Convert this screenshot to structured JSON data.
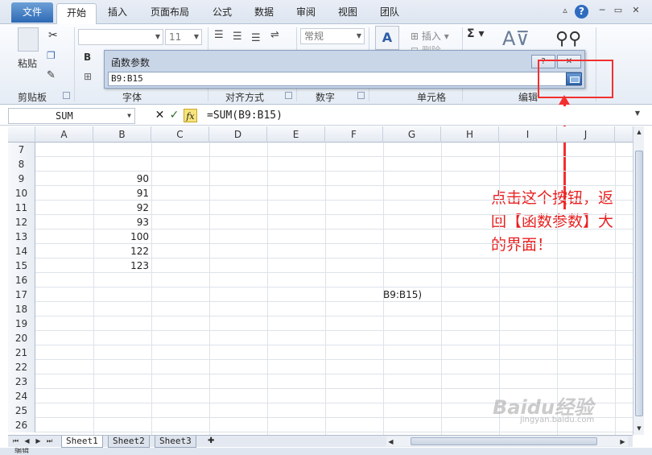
{
  "tabs": {
    "file": "文件",
    "items": [
      "开始",
      "插入",
      "页面布局",
      "公式",
      "数据",
      "审阅",
      "视图",
      "团队"
    ],
    "active_index": 0
  },
  "window_controls": {
    "help": "?",
    "minimize": "─",
    "restore": "▭",
    "close": "✕"
  },
  "ribbon": {
    "paste_label": "粘贴",
    "font_size": "11",
    "number_format": "常规",
    "insert_label": "插入",
    "delete_label": "删除",
    "sum_symbol": "Σ",
    "groups": [
      "剪贴板",
      "字体",
      "对齐方式",
      "数字",
      "单元格",
      "编辑"
    ]
  },
  "dialog": {
    "title": "函数参数",
    "help_btn": "?",
    "close_btn": "✕",
    "input_value": "B9:B15"
  },
  "formula_bar": {
    "name_box": "SUM",
    "cancel_icon": "✕",
    "enter_icon": "✓",
    "fx_label": "fx",
    "formula": "=SUM(B9:B15)"
  },
  "grid": {
    "columns": [
      "A",
      "B",
      "C",
      "D",
      "E",
      "F",
      "G",
      "H",
      "I",
      "J"
    ],
    "rows": [
      {
        "num": "7",
        "b": "",
        "g": ""
      },
      {
        "num": "8",
        "b": "",
        "g": ""
      },
      {
        "num": "9",
        "b": "90",
        "g": ""
      },
      {
        "num": "10",
        "b": "91",
        "g": ""
      },
      {
        "num": "11",
        "b": "92",
        "g": ""
      },
      {
        "num": "12",
        "b": "93",
        "g": ""
      },
      {
        "num": "13",
        "b": "100",
        "g": ""
      },
      {
        "num": "14",
        "b": "122",
        "g": ""
      },
      {
        "num": "15",
        "b": "123",
        "g": ""
      },
      {
        "num": "16",
        "b": "",
        "g": ""
      },
      {
        "num": "17",
        "b": "",
        "g": "B9:B15)"
      },
      {
        "num": "18",
        "b": "",
        "g": ""
      },
      {
        "num": "19",
        "b": "",
        "g": ""
      },
      {
        "num": "20",
        "b": "",
        "g": ""
      },
      {
        "num": "21",
        "b": "",
        "g": ""
      },
      {
        "num": "22",
        "b": "",
        "g": ""
      },
      {
        "num": "23",
        "b": "",
        "g": ""
      },
      {
        "num": "24",
        "b": "",
        "g": ""
      },
      {
        "num": "25",
        "b": "",
        "g": ""
      },
      {
        "num": "26",
        "b": "",
        "g": ""
      }
    ]
  },
  "sheets": [
    "Sheet1",
    "Sheet2",
    "Sheet3"
  ],
  "status": "编辑",
  "annotation": "点击这个按钮，返回【函数参数】大的界面！",
  "watermark": "Baidu经验",
  "watermark_sub": "jingyan.baidu.com",
  "colors": {
    "annotation_red": "#f23030",
    "file_tab": "#2c69b6"
  }
}
